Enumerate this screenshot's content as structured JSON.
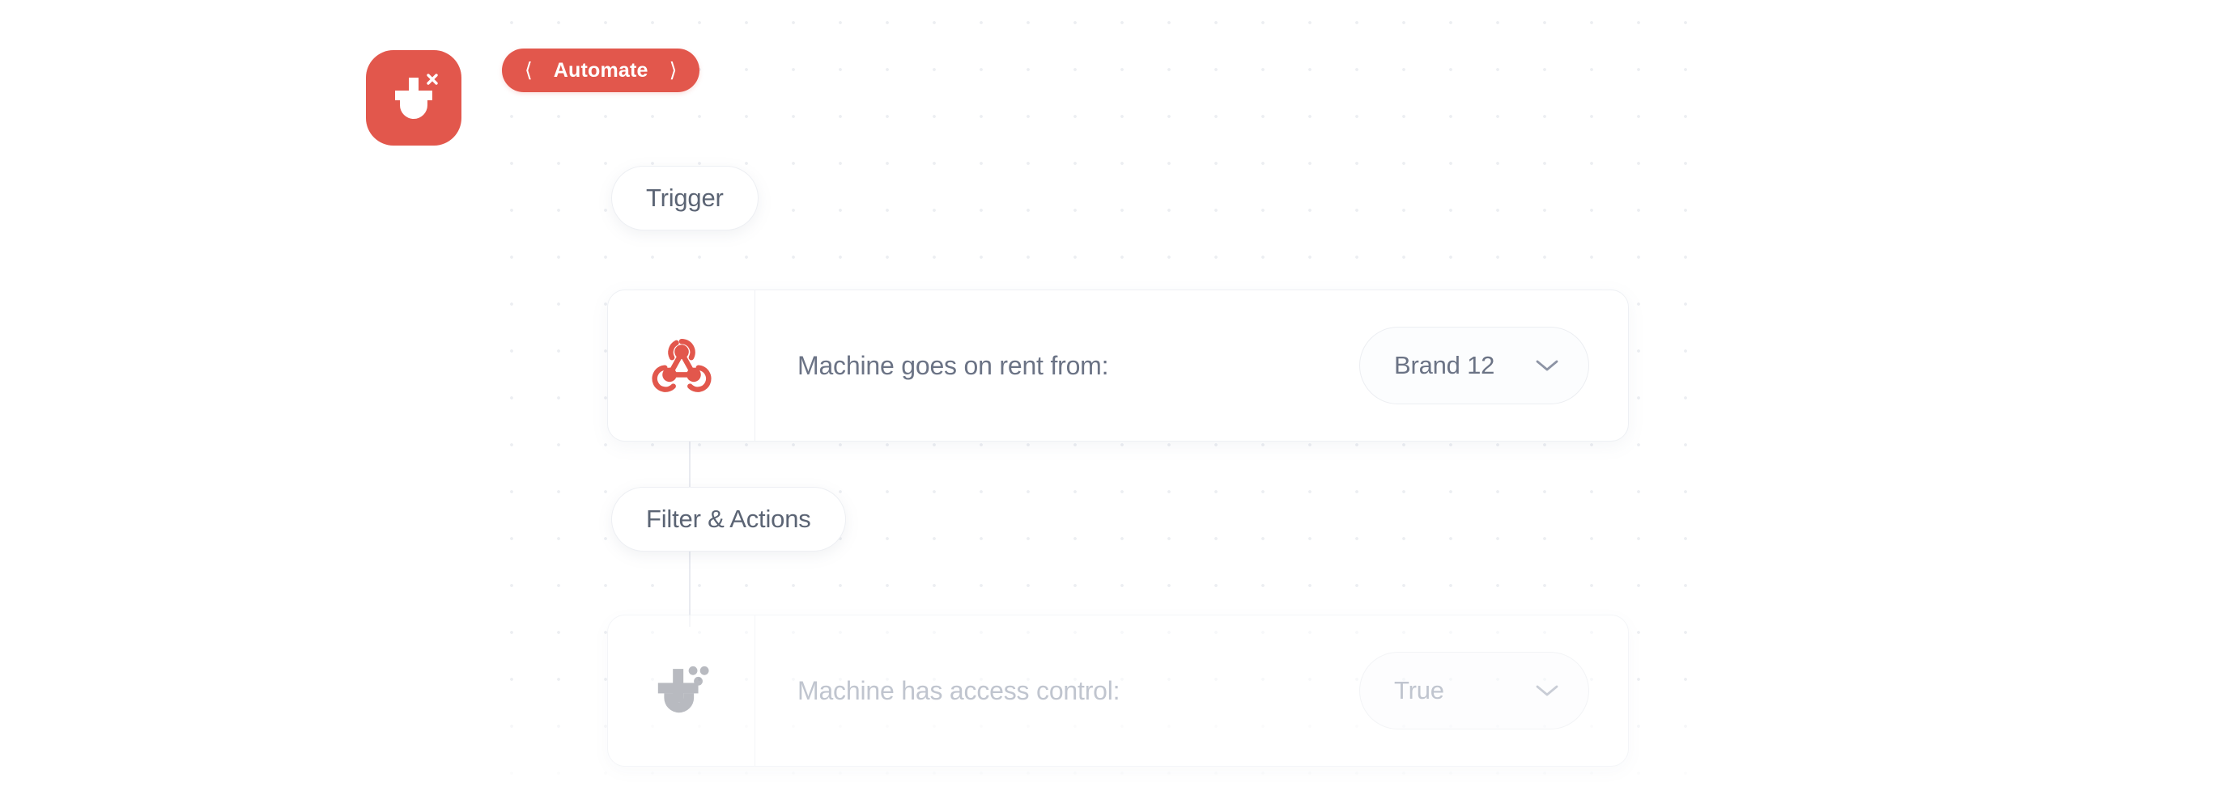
{
  "brand": {
    "logo_icon": "tractor-brand-logo-icon",
    "accent_color": "#e2574c",
    "logo_superscript": "x"
  },
  "header": {
    "automate": {
      "label": "Automate",
      "prev_icon": "chevron-left-icon",
      "next_icon": "chevron-right-icon"
    }
  },
  "canvas": {
    "background": "dotted-grid",
    "sections": [
      {
        "id": "trigger",
        "label": "Trigger"
      },
      {
        "id": "filter-actions",
        "label": "Filter & Actions"
      }
    ],
    "steps": [
      {
        "id": "trigger-step",
        "icon": "webhook-icon",
        "icon_color": "#e2574c",
        "label": "Machine goes on rent from:",
        "dropdown": {
          "value": "Brand 12",
          "chevron_icon": "chevron-down-icon"
        },
        "dimmed": false
      },
      {
        "id": "filter-step",
        "icon": "tractor-brand-logo-icon",
        "icon_color": "#8d919b",
        "label": "Machine has access control:",
        "dropdown": {
          "value": "True",
          "chevron_icon": "chevron-down-icon"
        },
        "dimmed": true
      }
    ]
  }
}
